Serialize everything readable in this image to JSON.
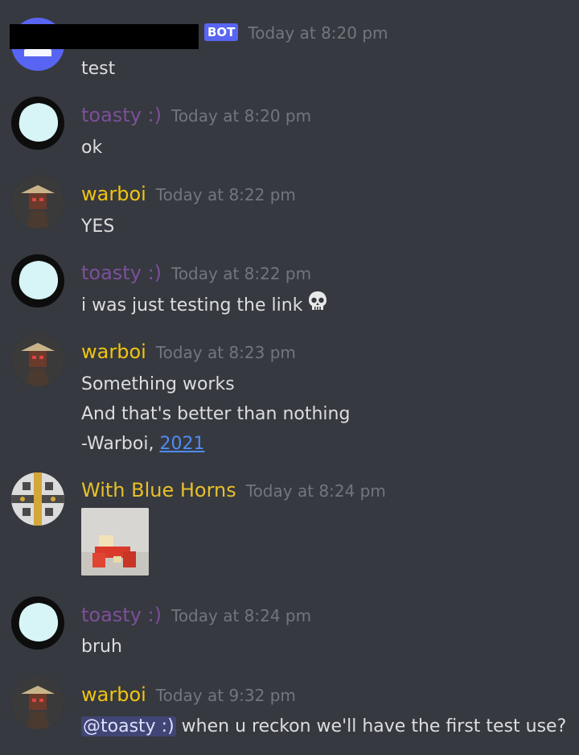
{
  "colors": {
    "background": "#36393f",
    "timestamp": "#72767d",
    "text": "#dcddde",
    "bot_badge": "#5865f2",
    "toasty": "#7d4f9b",
    "warboi": "#f1c40f",
    "blue_horns": "#e6c02a",
    "link": "#4f8cf5"
  },
  "messages": [
    {
      "author": "",
      "bot_badge": "BOT",
      "timestamp": "Today at 8:20 pm",
      "lines": [
        "test"
      ]
    },
    {
      "author": "toasty :)",
      "timestamp": "Today at 8:20 pm",
      "lines": [
        "ok"
      ]
    },
    {
      "author": "warboi",
      "timestamp": "Today at 8:22 pm",
      "lines": [
        "YES"
      ]
    },
    {
      "author": "toasty :)",
      "timestamp": "Today at 8:22 pm",
      "lines": [
        "i was just testing the link"
      ],
      "emoji": "skull-emoji"
    },
    {
      "author": "warboi",
      "timestamp": "Today at 8:23 pm",
      "lines": [
        "Something works",
        "And that's better than nothing",
        "-Warboi, "
      ],
      "link": "2021"
    },
    {
      "author": "With Blue Horns",
      "timestamp": "Today at 8:24 pm",
      "attachment": "image-attachment"
    },
    {
      "author": "toasty :)",
      "timestamp": "Today at 8:24 pm",
      "lines": [
        "bruh"
      ]
    },
    {
      "author": "warboi",
      "timestamp": "Today at 9:32 pm",
      "mention": "@toasty :)",
      "lines": [
        " when u reckon we'll have the first test use?"
      ]
    }
  ]
}
